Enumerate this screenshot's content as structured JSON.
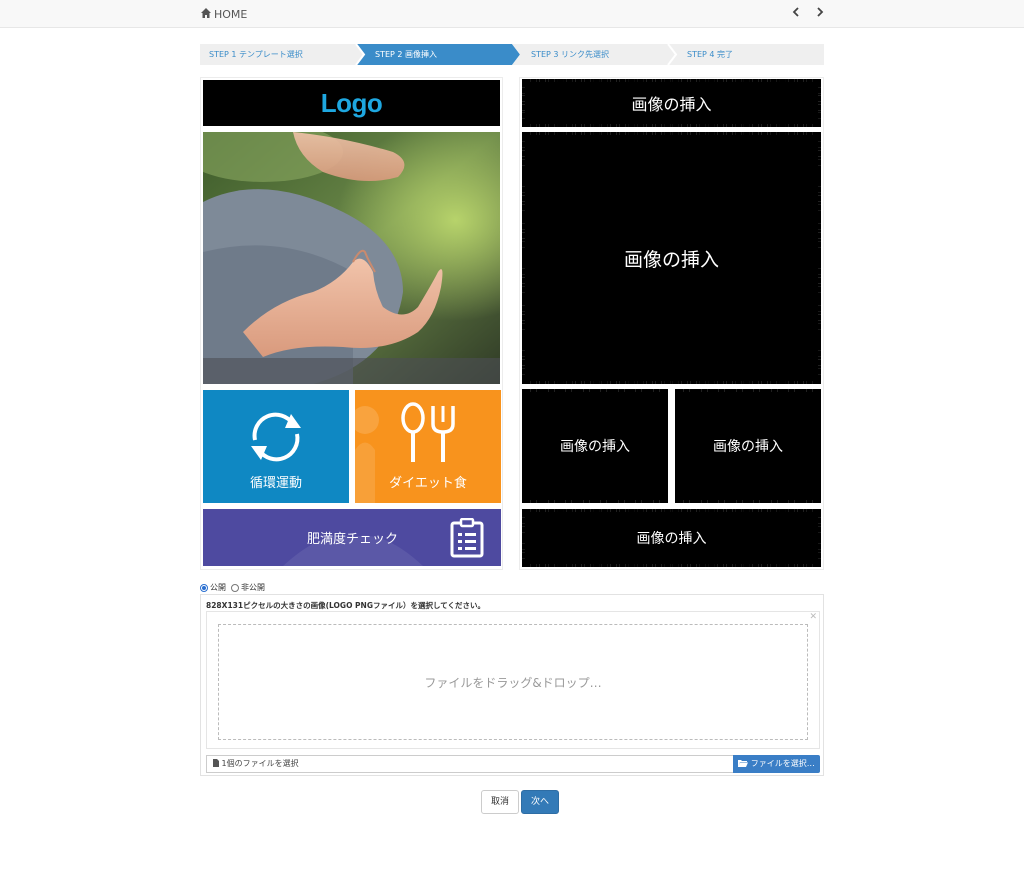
{
  "nav": {
    "home_label": "HOME",
    "prev_icon": "chevron-left-icon",
    "next_icon": "chevron-right-icon"
  },
  "steps": [
    {
      "label": "STEP 1 テンプレート選択",
      "active": false
    },
    {
      "label": "STEP 2 画像挿入",
      "active": true
    },
    {
      "label": "STEP 3 リンク先選択",
      "active": false
    },
    {
      "label": "STEP 4 完了",
      "active": false
    }
  ],
  "preview": {
    "logo_text": "Logo",
    "tiles": {
      "exercise": "循環運動",
      "diet": "ダイエット食",
      "obesity": "肥満度チェック"
    }
  },
  "slots": {
    "top": "画像の挿入",
    "large": "画像の挿入",
    "mid_left": "画像の挿入",
    "mid_right": "画像の挿入",
    "bottom": "画像の挿入"
  },
  "visibility": {
    "public_label": "公開",
    "private_label": "非公開",
    "selected": "public"
  },
  "upload": {
    "instruction": "828X131ピクセルの大きさの画像(LOGO PNGファイル）を選択してください。",
    "dropzone_text": "ファイルをドラッグ&ドロップ…",
    "file_count_text": "1個のファイルを選択",
    "browse_label": "ファイルを選択…"
  },
  "actions": {
    "cancel_label": "取消",
    "next_label": "次へ"
  },
  "colors": {
    "accent": "#3a8cc9",
    "tile_blue": "#0f88c3",
    "tile_orange": "#f8931d",
    "tile_purple": "#4e4aa0",
    "logo_blue": "#1ea7e0"
  }
}
